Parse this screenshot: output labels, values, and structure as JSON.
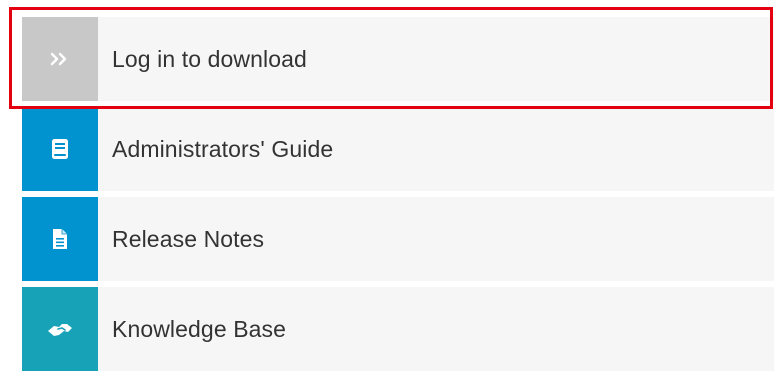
{
  "links": [
    {
      "label": "Log in to download",
      "icon": "double-chevron-right-icon",
      "icon_bg": "#c8c8c8"
    },
    {
      "label": "Administrators' Guide",
      "icon": "book-icon",
      "icon_bg": "#0093d0"
    },
    {
      "label": "Release Notes",
      "icon": "document-icon",
      "icon_bg": "#0093d0"
    },
    {
      "label": "Knowledge Base",
      "icon": "handshake-icon",
      "icon_bg": "#17a2b8"
    }
  ],
  "highlight_color": "#e3000f"
}
